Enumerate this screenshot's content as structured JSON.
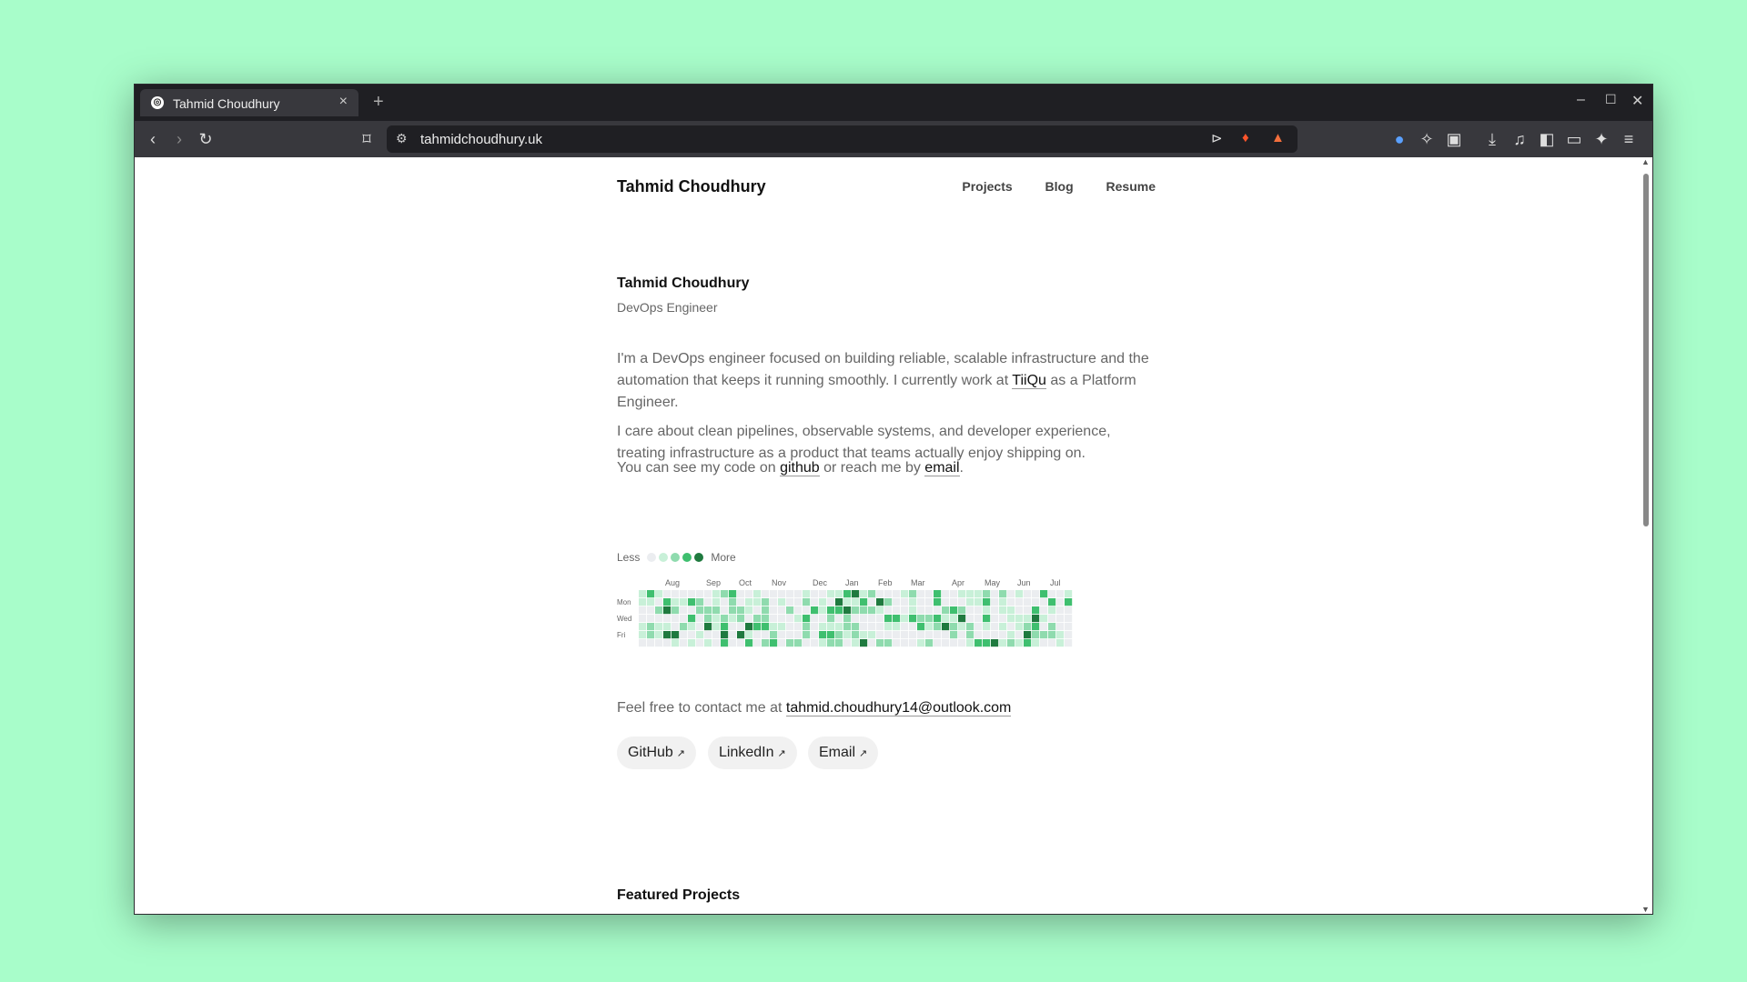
{
  "browser": {
    "tab_title": "Tahmid Choudhury",
    "url": "tahmidchoudhury.uk"
  },
  "site": {
    "name": "Tahmid Choudhury",
    "nav": [
      "Projects",
      "Blog",
      "Resume"
    ]
  },
  "hero": {
    "name": "Tahmid Choudhury",
    "role": "DevOps Engineer"
  },
  "bio": {
    "p1_before": "I'm a DevOps engineer focused on building reliable, scalable infrastructure and the automation that keeps it running smoothly. I currently work at ",
    "p1_link": "TiiQu",
    "p1_after": " as a Platform Engineer.",
    "p2": "I care about clean pipelines, observable systems, and developer experience, treating infrastructure as a product that teams actually enjoy shipping on.",
    "p3_before": "You can see my code on ",
    "p3_link1": "github",
    "p3_mid": " or reach me by ",
    "p3_link2": "email",
    "p3_after": "."
  },
  "contributions": {
    "legend_less": "Less",
    "legend_more": "More",
    "colors": [
      "#ebedf0",
      "#c8f0d8",
      "#8fdbae",
      "#3fbf6f",
      "#1f7a3f"
    ],
    "months": [
      "Aug",
      "Sep",
      "Oct",
      "Nov",
      "Dec",
      "Jan",
      "Feb",
      "Mar",
      "Apr",
      "May",
      "Jun",
      "Jul"
    ],
    "days": [
      "Mon",
      "Wed",
      "Fri"
    ]
  },
  "contact": {
    "text": "Feel free to contact me at ",
    "email": "tahmid.choudhury14@outlook.com"
  },
  "links": [
    {
      "label": "GitHub"
    },
    {
      "label": "LinkedIn"
    },
    {
      "label": "Email"
    }
  ],
  "featured_heading": "Featured Projects"
}
